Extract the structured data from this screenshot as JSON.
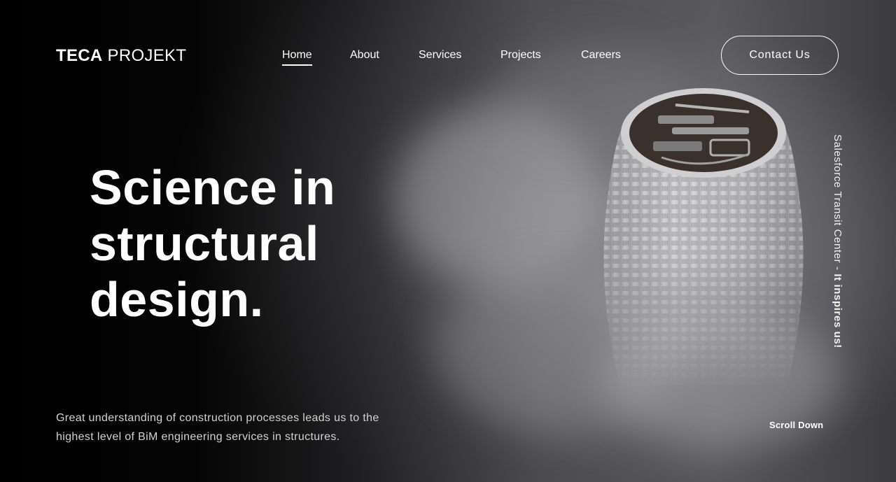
{
  "brand": {
    "name_bold": "TECA",
    "name_light": "PROJEKT"
  },
  "nav": {
    "items": [
      {
        "label": "Home",
        "active": true
      },
      {
        "label": "About",
        "active": false
      },
      {
        "label": "Services",
        "active": false
      },
      {
        "label": "Projects",
        "active": false
      },
      {
        "label": "Careers",
        "active": false
      }
    ]
  },
  "header": {
    "contact_label": "Contact Us"
  },
  "hero": {
    "headline_lines": [
      "Science in",
      "structural",
      "design."
    ],
    "tagline_lines": [
      "Great understanding of construction processes leads us to the",
      "highest level of BiM engineering services in structures."
    ],
    "image_caption_plain": "Salesforce Transit Center - ",
    "image_caption_bold": "It inspires us!",
    "scroll_label": "Scroll Down"
  },
  "colors": {
    "background": "#000000",
    "text": "#ffffff",
    "tagline_text": "#d2d2d2"
  }
}
